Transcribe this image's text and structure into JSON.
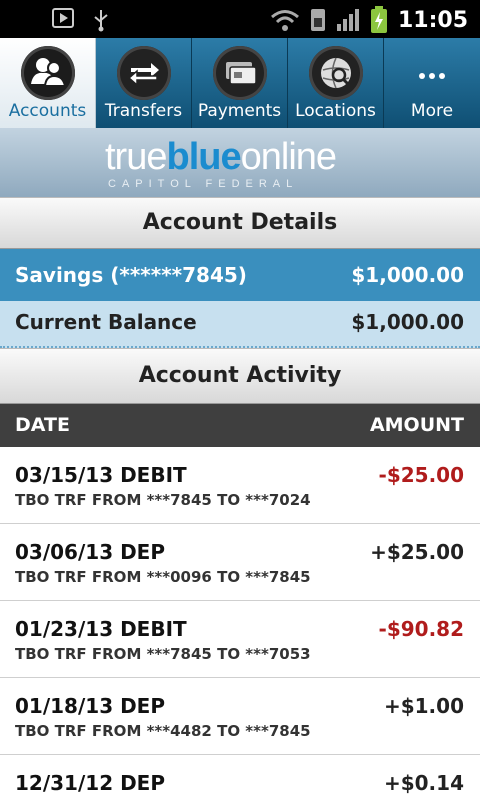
{
  "status_bar": {
    "time": "11:05",
    "icons": [
      "play-icon",
      "usb-icon",
      "wifi-icon",
      "sim-icon",
      "signal-icon",
      "battery-charging-icon"
    ]
  },
  "tabs": [
    {
      "label": "Accounts",
      "icon": "accounts-icon",
      "active": true
    },
    {
      "label": "Transfers",
      "icon": "transfers-icon",
      "active": false
    },
    {
      "label": "Payments",
      "icon": "payments-icon",
      "active": false
    },
    {
      "label": "Locations",
      "icon": "locations-icon",
      "active": false
    },
    {
      "label": "More",
      "icon": "more-icon",
      "active": false
    }
  ],
  "logo": {
    "part1": "true",
    "part2": "blue",
    "part3": "online",
    "sub": "CAPITOL FEDERAL"
  },
  "account_details": {
    "title": "Account Details",
    "account_name": "Savings (******7845)",
    "account_amount": "$1,000.00",
    "balance_label": "Current Balance",
    "balance_amount": "$1,000.00"
  },
  "activity": {
    "title": "Account Activity",
    "col_date": "DATE",
    "col_amount": "AMOUNT",
    "rows": [
      {
        "title": "03/15/13 DEBIT",
        "desc": "TBO TRF FROM ***7845 TO ***7024",
        "amount": "-$25.00"
      },
      {
        "title": "03/06/13 DEP",
        "desc": "TBO TRF FROM ***0096 TO ***7845",
        "amount": "+$25.00"
      },
      {
        "title": "01/23/13 DEBIT",
        "desc": "TBO TRF FROM ***7845 TO ***7053",
        "amount": "-$90.82"
      },
      {
        "title": "01/18/13 DEP",
        "desc": "TBO TRF FROM ***4482 TO ***7845",
        "amount": "+$1.00"
      },
      {
        "title": "12/31/12 DEP",
        "desc": "",
        "amount": "+$0.14"
      }
    ]
  },
  "colors": {
    "tab_bar": "#1b628c",
    "savings_row": "#3a8fbe",
    "balance_row": "#c7e0ef",
    "negative_amount": "#b01c1c",
    "logo_blue": "#1b8ccf"
  }
}
